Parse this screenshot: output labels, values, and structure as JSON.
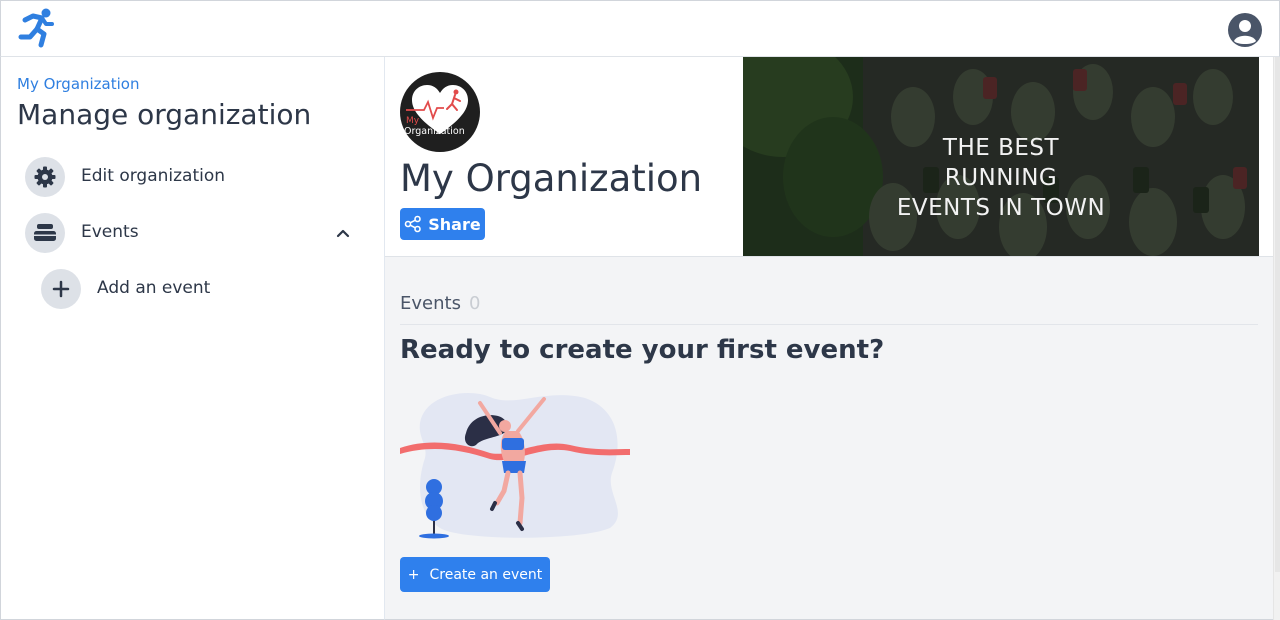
{
  "app": {
    "logo_icon": "running-man-icon",
    "account_icon": "user-circle-icon",
    "accent_color": "#2f80ed"
  },
  "sidebar": {
    "org_link": "My Organization",
    "title": "Manage organization",
    "items": [
      {
        "label": "Edit organization",
        "icon": "gear-icon"
      },
      {
        "label": "Events",
        "icon": "stack-icon",
        "expanded": true
      },
      {
        "label": "Add an event",
        "icon": "plus-icon"
      }
    ]
  },
  "org": {
    "logo_text_top": "My",
    "logo_text_bottom": "Organization",
    "name": "My Organization",
    "share_label": "Share",
    "banner_line1": "THE BEST RUNNING",
    "banner_line2": "EVENTS IN TOWN"
  },
  "events": {
    "heading": "Events",
    "count": "0",
    "empty_title": "Ready to create your first event?",
    "create_label": "Create an event",
    "create_icon": "+"
  }
}
